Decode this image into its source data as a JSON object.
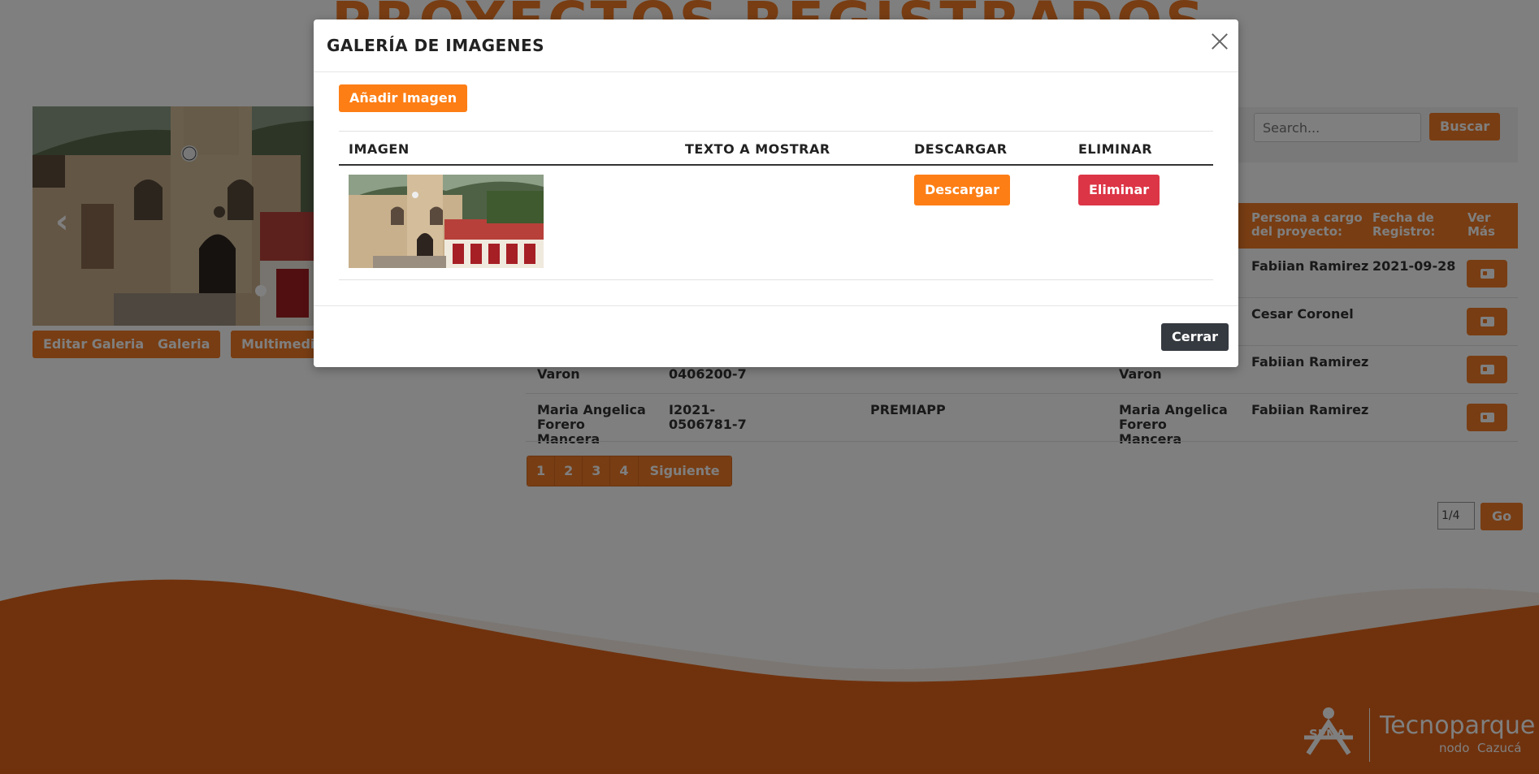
{
  "page": {
    "title": "PROYECTOS REGISTRADOS"
  },
  "carousel": {
    "prev_icon": "chevron-left-icon",
    "buttons": [
      "Editar Galeria",
      "Galeria",
      "Multimedia"
    ]
  },
  "search": {
    "placeholder": "Search...",
    "button_label": "Buscar"
  },
  "projects_table": {
    "headers": [
      "Persona a cargo del proyecto:",
      "Fecha de Registro:",
      "Ver Más"
    ],
    "rows": [
      {
        "encargado": "Fabiian Ramirez",
        "fecha": "2021-09-28"
      },
      {
        "encargado": "Cesar Coronel",
        "fecha": ""
      },
      {
        "nombre": "Varon",
        "codigo": "0406200-7",
        "proyecto": "",
        "talento": "Varon",
        "encargado": "Fabiian Ramirez",
        "fecha": ""
      },
      {
        "nombre": "Maria Angelica Forero Mancera",
        "codigo": "I2021-0506781-7",
        "proyecto": "PREMIAPP",
        "talento": "Maria Angelica Forero Mancera",
        "encargado": "Fabiian Ramirez",
        "fecha": ""
      }
    ]
  },
  "pagination": {
    "pages": [
      "1",
      "2",
      "3",
      "4"
    ],
    "next_label": "Siguiente",
    "current": "1/4",
    "go_label": "Go"
  },
  "footer": {
    "logo_text": "SENA",
    "brand": "Tecnoparque",
    "node_prefix": "nodo",
    "node_name": "Cazucá"
  },
  "modal": {
    "title": "GALERÍA DE IMAGENES",
    "add_button": "Añadir Imagen",
    "columns": [
      "IMAGEN",
      "TEXTO A MOSTRAR",
      "DESCARGAR",
      "ELIMINAR"
    ],
    "rows": [
      {
        "texto": "",
        "download_label": "Descargar",
        "delete_label": "Eliminar"
      }
    ],
    "close_label": "Cerrar",
    "close_icon": "close-icon"
  },
  "colors": {
    "brand_orange": "#f07a26",
    "button_orange": "#fd7e14",
    "danger": "#dc3545",
    "dark": "#343a40",
    "footer_orange": "#e0641b"
  }
}
